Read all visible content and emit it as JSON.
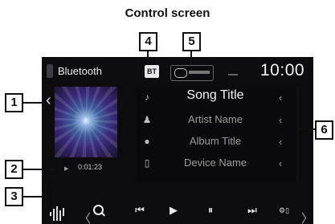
{
  "caption": "Control screen",
  "callouts": [
    "1",
    "2",
    "3",
    "4",
    "5",
    "6"
  ],
  "header": {
    "source_label": "Bluetooth",
    "bt_icon_label": "BT",
    "clock": "10:00"
  },
  "playback": {
    "state_icon": "▶",
    "time": "0:01:23"
  },
  "info_rows": [
    {
      "icon": "♪",
      "text": "Song Title",
      "chevron": "‹"
    },
    {
      "icon": "♟",
      "text": "Artist Name",
      "chevron": "‹"
    },
    {
      "icon": "●",
      "text": "Album Title",
      "chevron": "‹"
    },
    {
      "icon": "▯",
      "text": "Device Name",
      "chevron": "‹"
    }
  ],
  "controls": {
    "previous": "⏮",
    "play": "▶",
    "pause": "⏸",
    "next": "⏭"
  },
  "nav": {
    "back_chevron": "‹",
    "left": "〈",
    "right": "〉"
  },
  "icons": [
    "source-icon",
    "bluetooth-icon",
    "hands-free-phone-icon",
    "equalizer-icon",
    "search-icon",
    "previous-icon",
    "play-icon",
    "pause-icon",
    "next-icon",
    "settings-icon",
    "grid-menu-icon"
  ]
}
